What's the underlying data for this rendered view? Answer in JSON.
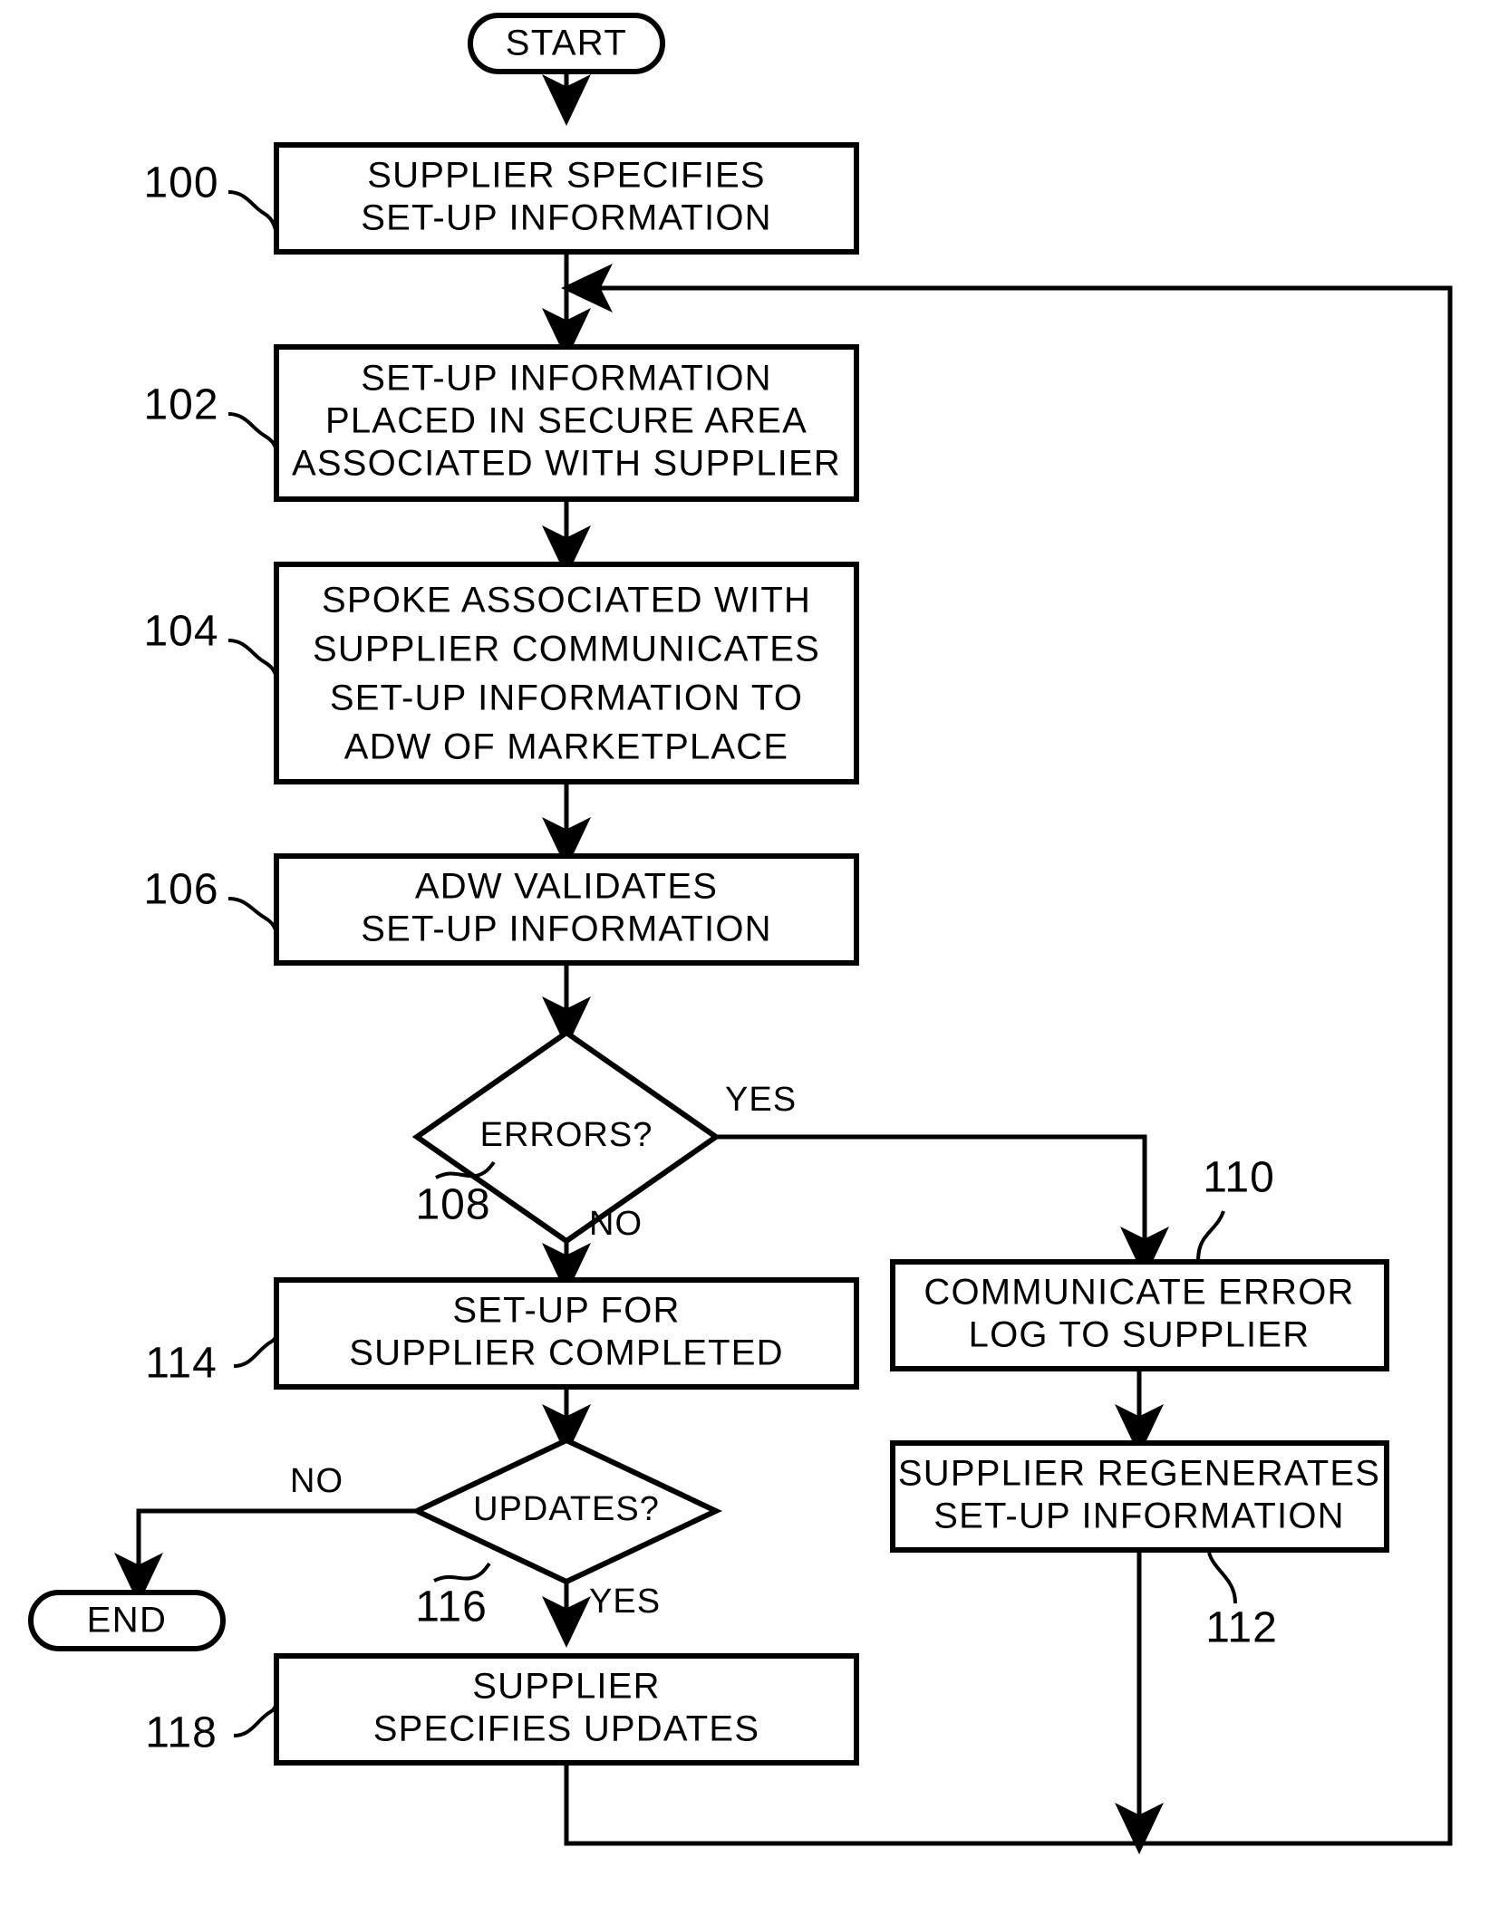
{
  "diagram": {
    "type": "flowchart",
    "title": "Supplier set-up information process flowchart",
    "line_color": "#000000",
    "background_color": "#ffffff",
    "terminals": [
      {
        "id": "start",
        "label": "START"
      },
      {
        "id": "end",
        "label": "END"
      }
    ],
    "process_boxes": [
      {
        "ref": "100",
        "lines": [
          "SUPPLIER SPECIFIES",
          "SET-UP INFORMATION"
        ]
      },
      {
        "ref": "102",
        "lines": [
          "SET-UP INFORMATION",
          "PLACED IN SECURE AREA",
          "ASSOCIATED WITH SUPPLIER"
        ]
      },
      {
        "ref": "104",
        "lines": [
          "SPOKE ASSOCIATED WITH",
          "SUPPLIER COMMUNICATES",
          "SET-UP INFORMATION TO",
          "ADW OF MARKETPLACE"
        ]
      },
      {
        "ref": "106",
        "lines": [
          "ADW VALIDATES",
          "SET-UP INFORMATION"
        ]
      },
      {
        "ref": "110",
        "lines": [
          "COMMUNICATE ERROR",
          "LOG TO SUPPLIER"
        ]
      },
      {
        "ref": "112",
        "lines": [
          "SUPPLIER REGENERATES",
          "SET-UP INFORMATION"
        ]
      },
      {
        "ref": "114",
        "lines": [
          "SET-UP FOR",
          "SUPPLIER COMPLETED"
        ]
      },
      {
        "ref": "118",
        "lines": [
          "SUPPLIER",
          "SPECIFIES UPDATES"
        ]
      }
    ],
    "decisions": [
      {
        "ref": "108",
        "label": "ERRORS?",
        "branch_yes": "YES",
        "branch_no": "NO"
      },
      {
        "ref": "116",
        "label": "UPDATES?",
        "branch_yes": "YES",
        "branch_no": "NO"
      }
    ],
    "edge_labels": {
      "errors_yes": "YES",
      "errors_no": "NO",
      "updates_no": "NO",
      "updates_yes": "YES"
    },
    "reference_numerals": [
      "100",
      "102",
      "104",
      "106",
      "108",
      "110",
      "112",
      "114",
      "116",
      "118"
    ]
  }
}
